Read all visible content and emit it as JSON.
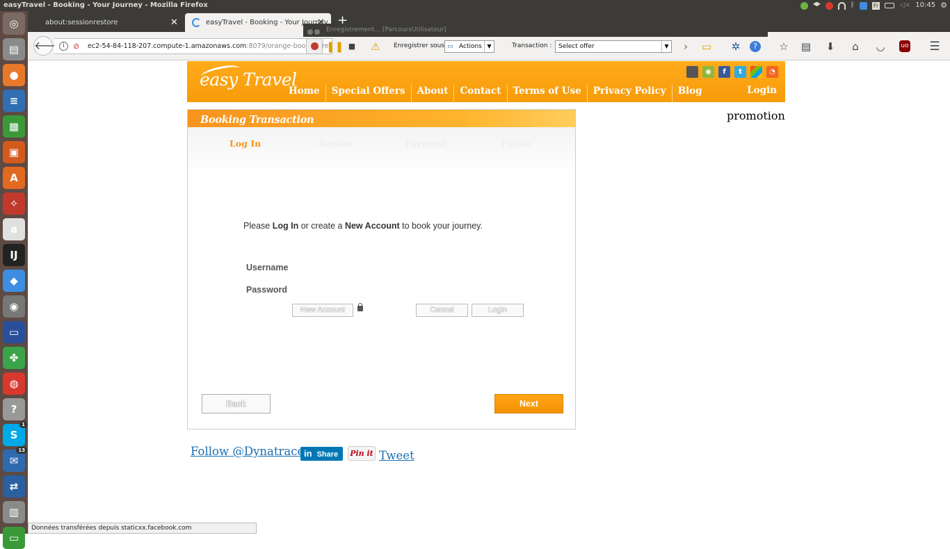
{
  "os": {
    "window_title": "easyTravel - Booking - Your Journey - Mozilla Firefox",
    "keyboard_layout": "Fr",
    "clock": "10:45"
  },
  "launcher": {
    "items": [
      {
        "name": "ubuntu-dash-icon",
        "glyph": "◎",
        "color": "#7a6a63"
      },
      {
        "name": "files-icon",
        "glyph": "▤",
        "color": "#8a8a8a"
      },
      {
        "name": "firefox-icon",
        "glyph": "●",
        "color": "#e8792b"
      },
      {
        "name": "writer-icon",
        "glyph": "≡",
        "color": "#2f6fb2"
      },
      {
        "name": "calc-icon",
        "glyph": "▦",
        "color": "#3a9a3a"
      },
      {
        "name": "impress-icon",
        "glyph": "▣",
        "color": "#d35a1e"
      },
      {
        "name": "software-center-icon",
        "glyph": "A",
        "color": "#e26a20"
      },
      {
        "name": "system-settings-icon",
        "glyph": "✧",
        "color": "#c0392b"
      },
      {
        "name": "amazon-icon",
        "glyph": "a",
        "color": "#e0e0e0"
      },
      {
        "name": "intellij-icon",
        "glyph": "IJ",
        "color": "#222"
      },
      {
        "name": "dropbox-icon",
        "glyph": "◆",
        "color": "#3d8ee0"
      },
      {
        "name": "gimp-icon",
        "glyph": "◉",
        "color": "#777"
      },
      {
        "name": "remote-desktop-icon",
        "glyph": "▭",
        "color": "#2a4f9a"
      },
      {
        "name": "pinwheel-icon",
        "glyph": "✤",
        "color": "#3ba44a"
      },
      {
        "name": "chrome-icon",
        "glyph": "◍",
        "color": "#d9382f"
      },
      {
        "name": "help-icon",
        "glyph": "?",
        "color": "#999"
      },
      {
        "name": "skype-icon",
        "glyph": "S",
        "color": "#00a9e8",
        "badge": "1"
      },
      {
        "name": "thunderbird-icon",
        "glyph": "✉",
        "color": "#2f6ab0",
        "badge": "13"
      },
      {
        "name": "network-icon",
        "glyph": "⇄",
        "color": "#2a5fa0"
      },
      {
        "name": "storage-icon",
        "glyph": "▥",
        "color": "#8a8a8a"
      },
      {
        "name": "monitor-icon",
        "glyph": "▭",
        "color": "#3a9a3a"
      }
    ]
  },
  "browser": {
    "tabs": [
      {
        "label": "about:sessionrestore",
        "active": false
      },
      {
        "label": "easyTravel - Booking - Your Journey",
        "active": true
      }
    ],
    "url_host": "ec2-54-84-118-207.compute-1.amazonaws.com",
    "url_rest": ":8079/orange-booking-review",
    "recorder_title": "Enregistrement... [ParcoursUtilisateur]",
    "record_as_label": "Enregistrer sous :",
    "record_as_value": "Actions",
    "transaction_label": "Transaction :",
    "transaction_value": "Select offer",
    "status_text": "Données transférées depuis staticxx.facebook.com"
  },
  "site": {
    "logo_text": "easy Travel",
    "nav": [
      "Home",
      "Special Offers",
      "About",
      "Contact",
      "Terms of Use",
      "Privacy Policy",
      "Blog"
    ],
    "login_link": "Login",
    "social_icons": [
      "apple-icon",
      "android-icon",
      "facebook-icon",
      "twitter-icon",
      "windows-icon",
      "rss-icon"
    ],
    "promotion": "promotion"
  },
  "booking": {
    "title": "Booking Transaction",
    "steps": [
      "Log In",
      "Review",
      "Payment",
      "Finish"
    ],
    "active_step": "Log In",
    "intro_prefix": "Please",
    "intro_login": "Log In",
    "intro_middle": "or create a",
    "intro_new_account": "New Account",
    "intro_suffix": "to book your journey.",
    "username_label": "Username",
    "password_label": "Password",
    "username_value": "",
    "password_value": "",
    "new_account_button": "New Account",
    "cancel_button": "Cancel",
    "login_button": "Login",
    "back_button": "Back",
    "next_button": "Next"
  },
  "footer": {
    "follow_link": "Follow @Dynatrace",
    "linkedin_share": "Share",
    "pinit": "Pin it",
    "tweet_link": "Tweet"
  }
}
